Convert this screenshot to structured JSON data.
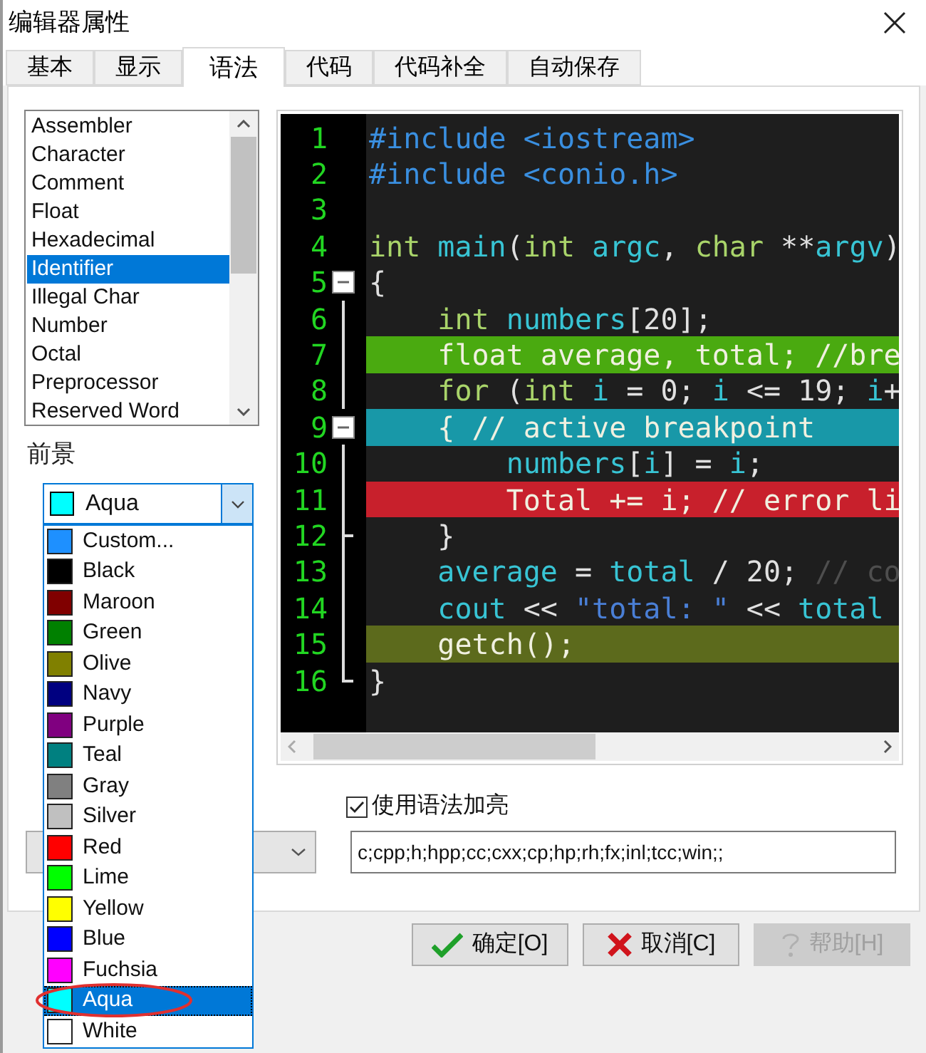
{
  "window": {
    "title": "编辑器属性"
  },
  "tabs": [
    {
      "label": "基本",
      "selected": false
    },
    {
      "label": "显示",
      "selected": false
    },
    {
      "label": "语法",
      "selected": true
    },
    {
      "label": "代码",
      "selected": false
    },
    {
      "label": "代码补全",
      "selected": false
    },
    {
      "label": "自动保存",
      "selected": false
    }
  ],
  "token_list": {
    "items": [
      {
        "label": "Assembler",
        "selected": false
      },
      {
        "label": "Character",
        "selected": false
      },
      {
        "label": "Comment",
        "selected": false
      },
      {
        "label": "Float",
        "selected": false
      },
      {
        "label": "Hexadecimal",
        "selected": false
      },
      {
        "label": "Identifier",
        "selected": true
      },
      {
        "label": "Illegal Char",
        "selected": false
      },
      {
        "label": "Number",
        "selected": false
      },
      {
        "label": "Octal",
        "selected": false
      },
      {
        "label": "Preprocessor",
        "selected": false
      },
      {
        "label": "Reserved Word",
        "selected": false
      }
    ]
  },
  "foreground": {
    "label": "前景",
    "value": "Aqua"
  },
  "color_dropdown": {
    "options": [
      {
        "label": "Custom...",
        "color": "#1e90ff",
        "selected": false
      },
      {
        "label": "Black",
        "color": "#000000",
        "selected": false
      },
      {
        "label": "Maroon",
        "color": "#800000",
        "selected": false
      },
      {
        "label": "Green",
        "color": "#008000",
        "selected": false
      },
      {
        "label": "Olive",
        "color": "#808000",
        "selected": false
      },
      {
        "label": "Navy",
        "color": "#000080",
        "selected": false
      },
      {
        "label": "Purple",
        "color": "#800080",
        "selected": false
      },
      {
        "label": "Teal",
        "color": "#008080",
        "selected": false
      },
      {
        "label": "Gray",
        "color": "#808080",
        "selected": false
      },
      {
        "label": "Silver",
        "color": "#c0c0c0",
        "selected": false
      },
      {
        "label": "Red",
        "color": "#ff0000",
        "selected": false
      },
      {
        "label": "Lime",
        "color": "#00ff00",
        "selected": false
      },
      {
        "label": "Yellow",
        "color": "#ffff00",
        "selected": false
      },
      {
        "label": "Blue",
        "color": "#0000ff",
        "selected": false
      },
      {
        "label": "Fuchsia",
        "color": "#ff00ff",
        "selected": false
      },
      {
        "label": "Aqua",
        "color": "#00ffff",
        "selected": true
      },
      {
        "label": "White",
        "color": "#ffffff",
        "selected": false
      }
    ]
  },
  "editor": {
    "lines": [
      {
        "number": "1",
        "kind": "plain",
        "tokens": [
          {
            "kind": "pre",
            "text": "#include <iostream>"
          }
        ]
      },
      {
        "number": "2",
        "kind": "plain",
        "tokens": [
          {
            "kind": "pre",
            "text": "#include <conio.h>"
          }
        ]
      },
      {
        "number": "3",
        "kind": "plain"
      },
      {
        "number": "4",
        "kind": "plain",
        "tokens": [
          {
            "kind": "kw",
            "text": "int"
          },
          {
            "kind": "id",
            "text": " main"
          },
          {
            "kind": "p",
            "text": "("
          },
          {
            "kind": "kw",
            "text": "int"
          },
          {
            "kind": "id",
            "text": " argc"
          },
          {
            "kind": "p",
            "text": ", "
          },
          {
            "kind": "kw",
            "text": "char"
          },
          {
            "kind": "p",
            "text": " **"
          },
          {
            "kind": "id",
            "text": "argv"
          },
          {
            "kind": "p",
            "text": ")"
          }
        ]
      },
      {
        "number": "5",
        "kind": "fold_start",
        "tokens": [
          {
            "kind": "p",
            "text": "{"
          }
        ]
      },
      {
        "number": "6",
        "kind": "guide",
        "tokens": [
          {
            "kind": "kw",
            "text": "    int"
          },
          {
            "kind": "id",
            "text": " numbers"
          },
          {
            "kind": "p",
            "text": "[20];"
          }
        ]
      },
      {
        "number": "7",
        "kind": "guide",
        "color": "#4aaa10",
        "text": "    float average, total; //bre"
      },
      {
        "number": "8",
        "kind": "guide",
        "tokens": [
          {
            "kind": "kw",
            "text": "    for"
          },
          {
            "kind": "p",
            "text": " ("
          },
          {
            "kind": "kw",
            "text": "int"
          },
          {
            "kind": "id",
            "text": " i"
          },
          {
            "kind": "p",
            "text": " = 0; "
          },
          {
            "kind": "id",
            "text": "i"
          },
          {
            "kind": "p",
            "text": " <= 19; "
          },
          {
            "kind": "id",
            "text": "i"
          },
          {
            "kind": "p",
            "text": "+"
          }
        ]
      },
      {
        "number": "9",
        "kind": "fold_start",
        "color": "#1898a8",
        "text": "    { // active breakpoint"
      },
      {
        "number": "10",
        "kind": "guide",
        "tokens": [
          {
            "kind": "id",
            "text": "        numbers"
          },
          {
            "kind": "p",
            "text": "["
          },
          {
            "kind": "id",
            "text": "i"
          },
          {
            "kind": "p",
            "text": "] = "
          },
          {
            "kind": "id",
            "text": "i"
          },
          {
            "kind": "p",
            "text": ";"
          }
        ]
      },
      {
        "number": "11",
        "kind": "guide",
        "color": "#c8202c",
        "text": "        Total += i; // error li"
      },
      {
        "number": "12",
        "kind": "guide_branch",
        "tokens": [
          {
            "kind": "p",
            "text": "    }"
          }
        ]
      },
      {
        "number": "13",
        "kind": "guide",
        "tokens": [
          {
            "kind": "id",
            "text": "    average"
          },
          {
            "kind": "p",
            "text": " = "
          },
          {
            "kind": "id",
            "text": "total"
          },
          {
            "kind": "p",
            "text": " / 20; "
          },
          {
            "kind": "cm",
            "text": "// co"
          }
        ]
      },
      {
        "number": "14",
        "kind": "guide",
        "tokens": [
          {
            "kind": "id",
            "text": "    cout"
          },
          {
            "kind": "p",
            "text": " << "
          },
          {
            "kind": "str",
            "text": "\"total: \""
          },
          {
            "kind": "p",
            "text": " << "
          },
          {
            "kind": "id",
            "text": "total"
          }
        ]
      },
      {
        "number": "15",
        "kind": "guide",
        "color": "#5c6a1c",
        "text": "    getch();"
      },
      {
        "number": "16",
        "kind": "guide_end",
        "tokens": [
          {
            "kind": "p",
            "text": "}"
          }
        ]
      }
    ]
  },
  "syntax_highlight": {
    "label": "使用语法加亮",
    "checked": true
  },
  "extensions": {
    "value": "c;cpp;h;hpp;cc;cxx;cp;hp;rh;fx;inl;tcc;win;;"
  },
  "buttons": [
    {
      "label": "确定[O]",
      "kind": "ok",
      "disabled": false
    },
    {
      "label": "取消[C]",
      "kind": "cancel",
      "disabled": false
    },
    {
      "label": "帮助[H]",
      "kind": "help",
      "disabled": true
    }
  ]
}
